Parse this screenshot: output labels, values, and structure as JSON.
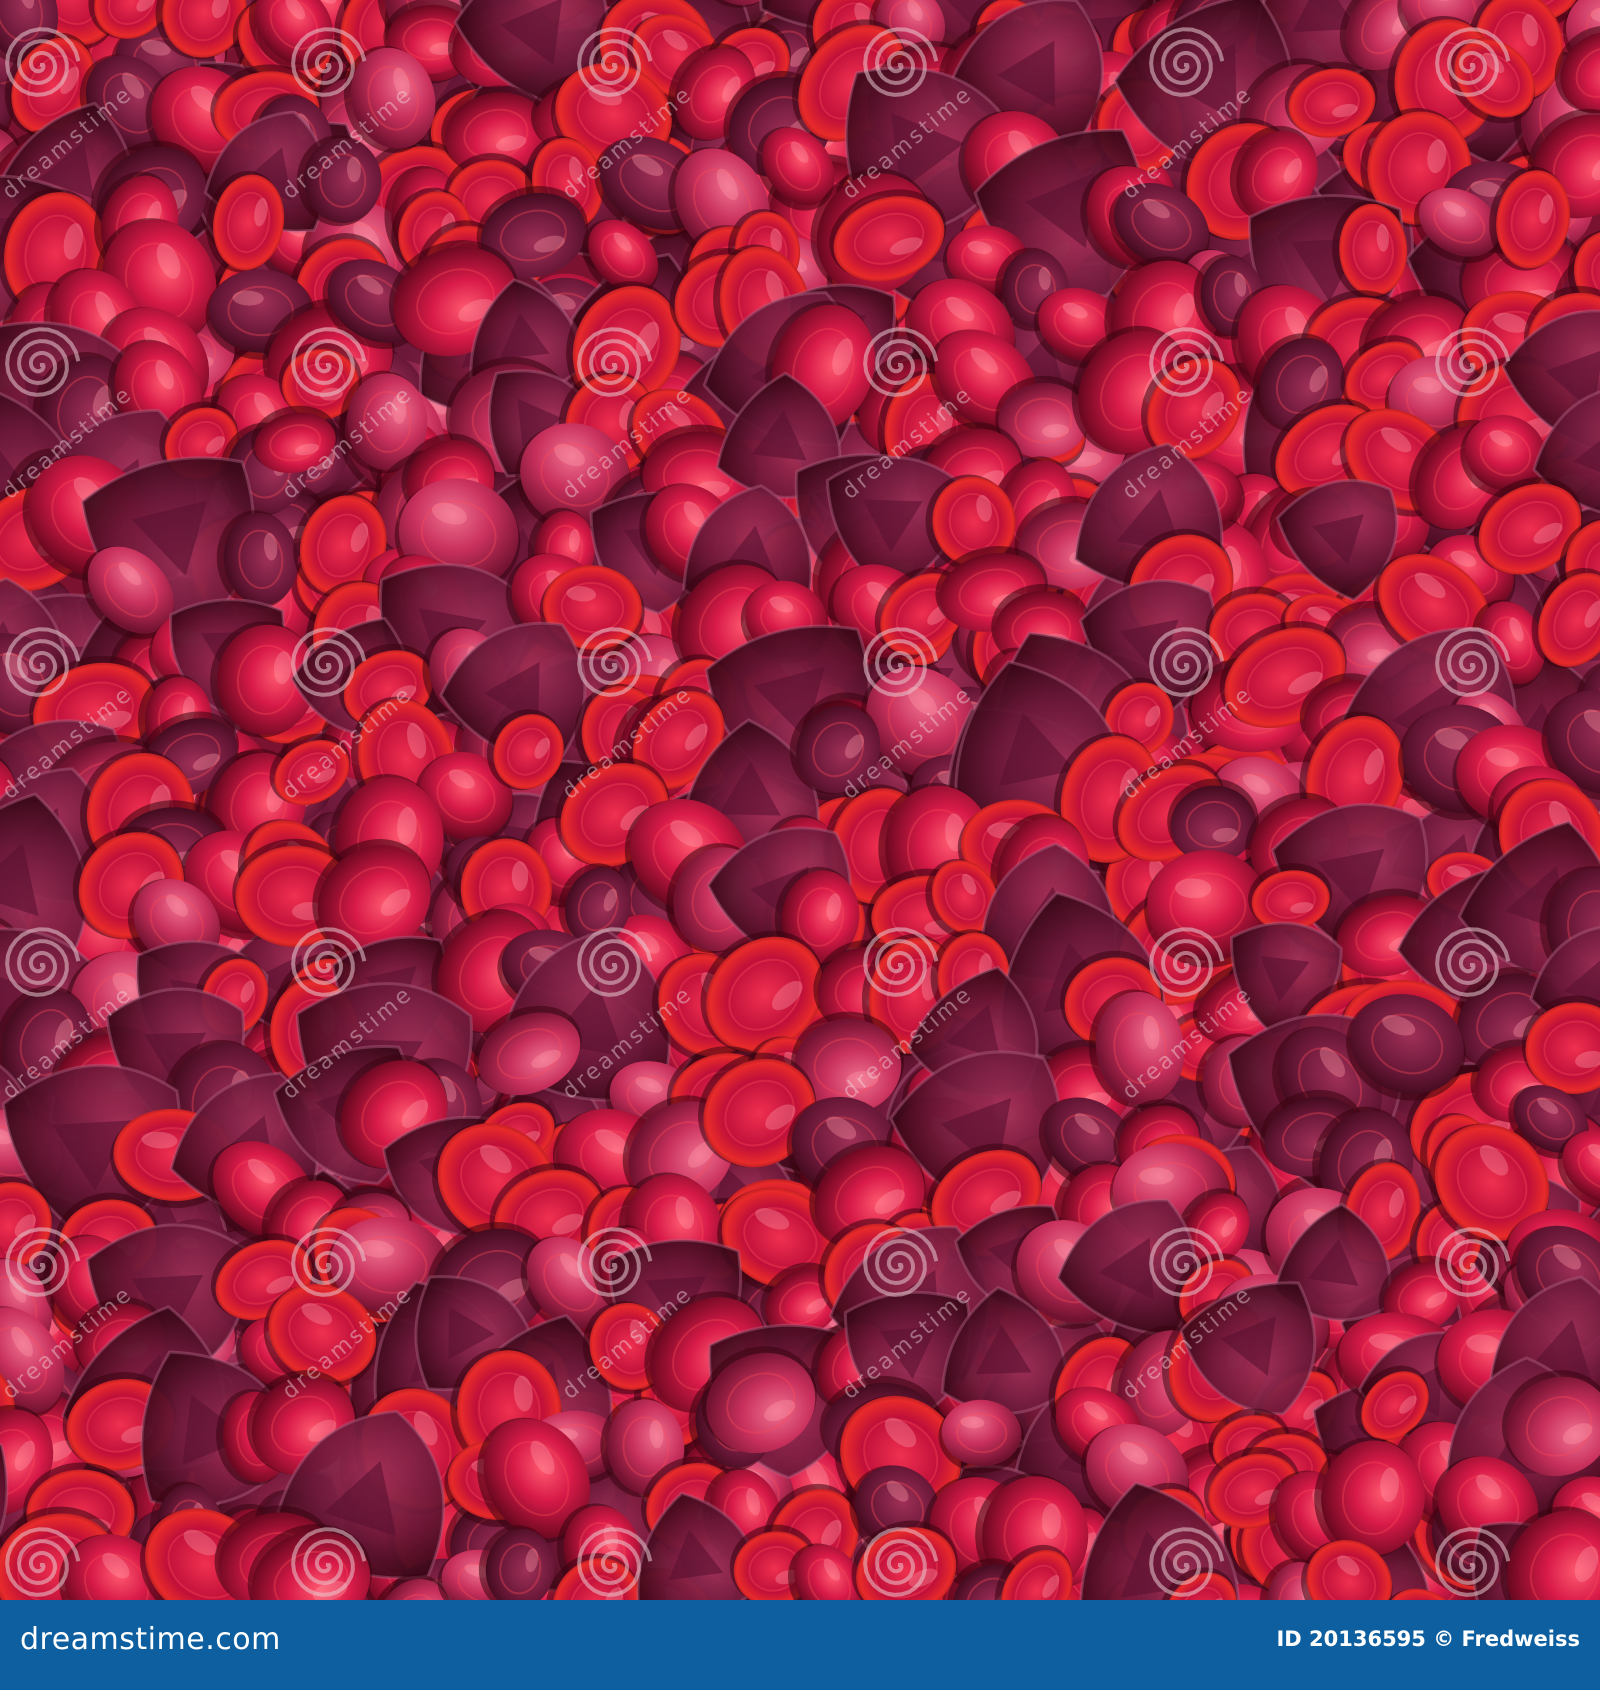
{
  "photo": {
    "subject": "",
    "colors": {
      "background": "#7a1230",
      "gem_deep": "#5a0a24",
      "gem_ruby": "#c01240",
      "gem_bright": "#e8283c",
      "gem_rose": "#d8406a",
      "gem_plum": "#6a2040",
      "highlight": "#ff6a72"
    }
  },
  "watermark": {
    "text": "dreamstime",
    "logo_icon": "spiral-swirl"
  },
  "footer": {
    "site": "dreamstime.com",
    "credit": "ID 20136595 © Fredweiss",
    "background": "#0d5fa0",
    "text_color": "#ffffff"
  }
}
